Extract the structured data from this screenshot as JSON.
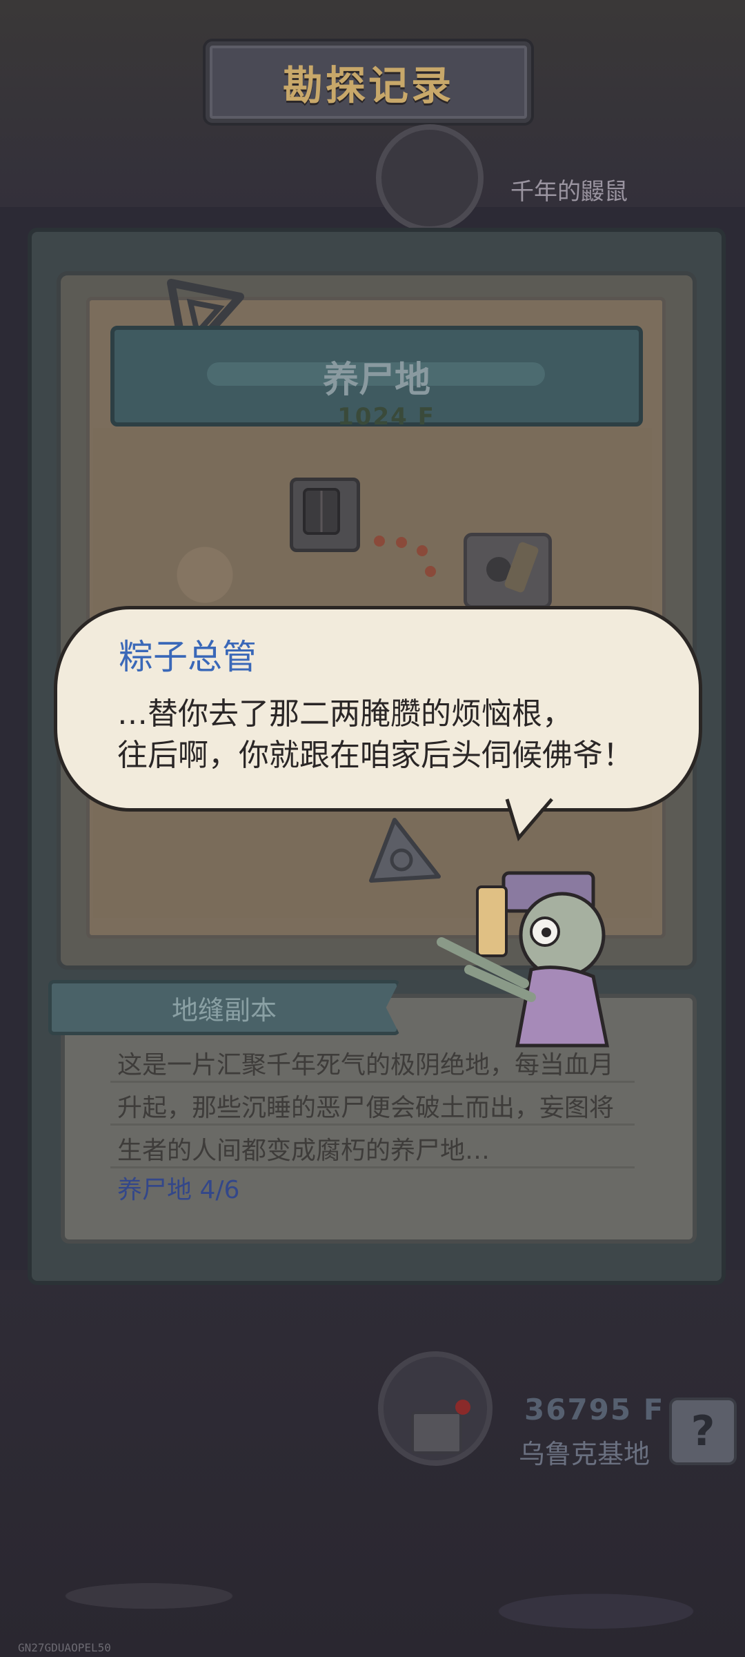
{
  "header": {
    "title": "勘探记录"
  },
  "top_hint": {
    "label": "千年的鼹鼠"
  },
  "zone": {
    "name": "养尸地",
    "floor": "1024 F"
  },
  "dialog": {
    "speaker": "粽子总管",
    "lines": [
      "…替你去了那二两腌臜的烦恼根，",
      "往后啊，你就跟在咱家后头伺候佛爷！"
    ]
  },
  "description": {
    "tab_label": "地缝副本",
    "lines": [
      "这是一片汇聚千年死气的极阴绝地，每当血月",
      "升起，那些沉睡的恶尸便会破土而出，妄图将",
      "生者的人间都变成腐朽的养尸地…"
    ],
    "progress": "养尸地  4/6"
  },
  "bottom_station": {
    "floor": "36795 F",
    "name": "乌鲁克基地"
  },
  "help": {
    "label": "?"
  },
  "build_id": "GN27GDUAOPEL50",
  "colors": {
    "speaker": "#3a68b8",
    "bubble_bg": "#f2ebdc",
    "header_text": "#c8a86a"
  },
  "icons": [
    "triangle-emblem-icon",
    "door-icon",
    "portal-icon",
    "pyramid-icon",
    "map-icon",
    "question-icon"
  ]
}
